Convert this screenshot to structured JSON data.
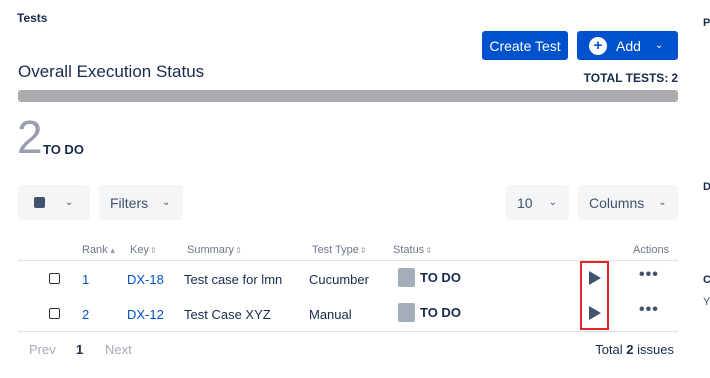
{
  "section_title": "Tests",
  "right_panel": {
    "items": [
      "P",
      "D",
      "C",
      "Y"
    ]
  },
  "buttons": {
    "create_test": "Create Test",
    "add": "Add"
  },
  "overall": {
    "title": "Overall Execution Status",
    "total_label": "TOTAL TESTS:",
    "total_value": "2"
  },
  "summary": {
    "count": "2",
    "label": "TO DO"
  },
  "toolbar": {
    "filters": "Filters",
    "page_size": "10",
    "columns": "Columns"
  },
  "table": {
    "headers": {
      "rank": "Rank",
      "key": "Key",
      "summary": "Summary",
      "test_type": "Test Type",
      "status": "Status",
      "actions": "Actions"
    },
    "rows": [
      {
        "rank": "1",
        "key": "DX-18",
        "summary": "Test case for lmn",
        "test_type": "Cucumber",
        "status": "TO DO"
      },
      {
        "rank": "2",
        "key": "DX-12",
        "summary": "Test Case XYZ",
        "test_type": "Manual",
        "status": "TO DO"
      }
    ]
  },
  "pagination": {
    "prev": "Prev",
    "page": "1",
    "next": "Next",
    "total_prefix": "Total",
    "total_count": "2",
    "total_suffix": "issues"
  },
  "colors": {
    "primary": "#0052cc",
    "status_todo": "#a5adba",
    "highlight": "#e3242b"
  }
}
